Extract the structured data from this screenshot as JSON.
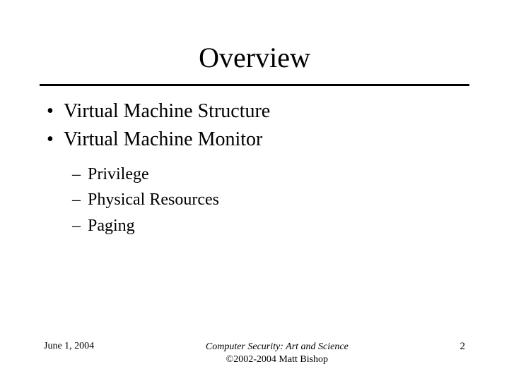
{
  "title": "Overview",
  "bullets": [
    {
      "text": "Virtual Machine Structure"
    },
    {
      "text": "Virtual Machine Monitor"
    }
  ],
  "sub_bullets": [
    {
      "text": "Privilege"
    },
    {
      "text": "Physical Resources"
    },
    {
      "text": "Paging"
    }
  ],
  "footer": {
    "date": "June 1, 2004",
    "book_title": "Computer Security: Art and Science",
    "copyright": "©2002-2004 Matt Bishop",
    "page_number": "2"
  }
}
